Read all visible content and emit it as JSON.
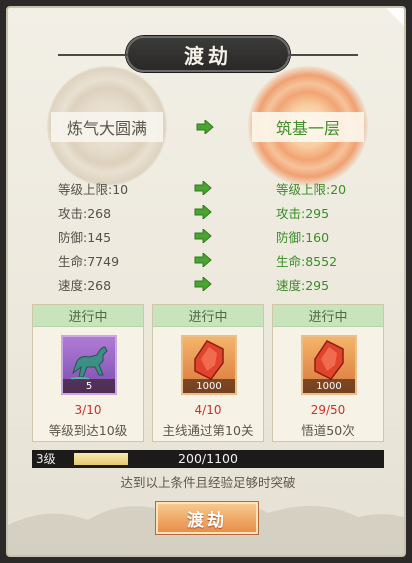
{
  "title": "渡劫",
  "realm": {
    "current": "炼气大圆满",
    "next": "筑基一层"
  },
  "stats": [
    {
      "old": "等级上限:10",
      "new": "等级上限:20"
    },
    {
      "old": "攻击:268",
      "new": "攻击:295"
    },
    {
      "old": "防御:145",
      "new": "防御:160"
    },
    {
      "old": "生命:7749",
      "new": "生命:8552"
    },
    {
      "old": "速度:268",
      "new": "速度:295"
    }
  ],
  "conditions": [
    {
      "status": "进行中",
      "item_count": "5",
      "progress": "3/10",
      "requirement": "等级到达10级",
      "item_icon": "bronze-horse-icon"
    },
    {
      "status": "进行中",
      "item_count": "1000",
      "progress": "4/10",
      "requirement": "主线通过第10关",
      "item_icon": "red-crystal-icon"
    },
    {
      "status": "进行中",
      "item_count": "1000",
      "progress": "29/50",
      "requirement": "悟道50次",
      "item_icon": "red-crystal-icon"
    }
  ],
  "experience": {
    "level": "3级",
    "value": "200/1100",
    "fill_fraction": 0.18
  },
  "hint": "达到以上条件且经验足够时突破",
  "button_label": "渡劫",
  "colors": {
    "upgrade_green": "#3a8d27",
    "progress_red": "#c8322a",
    "button_orange": "#e98e4a"
  }
}
